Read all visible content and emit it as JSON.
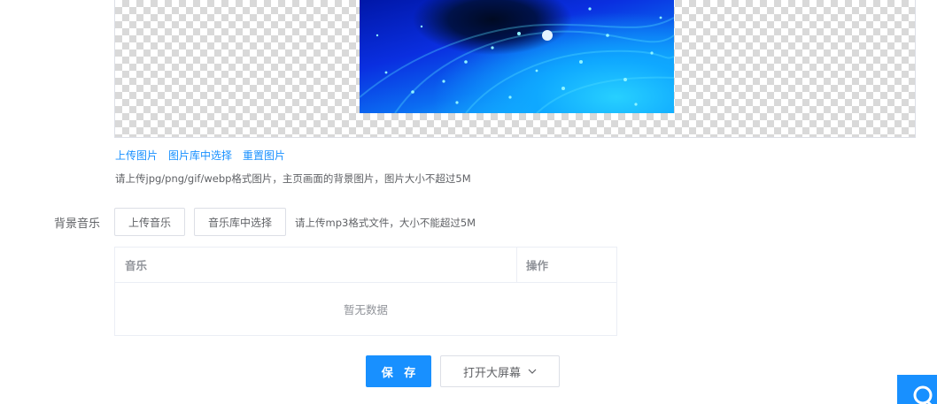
{
  "image_section": {
    "upload_link": "上传图片",
    "library_link": "图片库中选择",
    "reset_link": "重置图片",
    "tip": "请上传jpg/png/gif/webp格式图片，主页画面的背景图片，图片大小不超过5M"
  },
  "music_section": {
    "label": "背景音乐",
    "upload_button": "上传音乐",
    "library_button": "音乐库中选择",
    "tip": "请上传mp3格式文件，大小不能超过5M",
    "table": {
      "columns": [
        "音乐",
        "操作"
      ],
      "empty_text": "暂无数据"
    }
  },
  "footer": {
    "save_button": "保 存",
    "open_screen_button": "打开大屏幕"
  },
  "colors": {
    "primary": "#1890ff",
    "text": "#606266",
    "muted": "#909399",
    "border": "#dcdfe6"
  },
  "icons": {
    "dropdown": "chevron-down-icon",
    "float_widget": "customer-service-icon"
  }
}
